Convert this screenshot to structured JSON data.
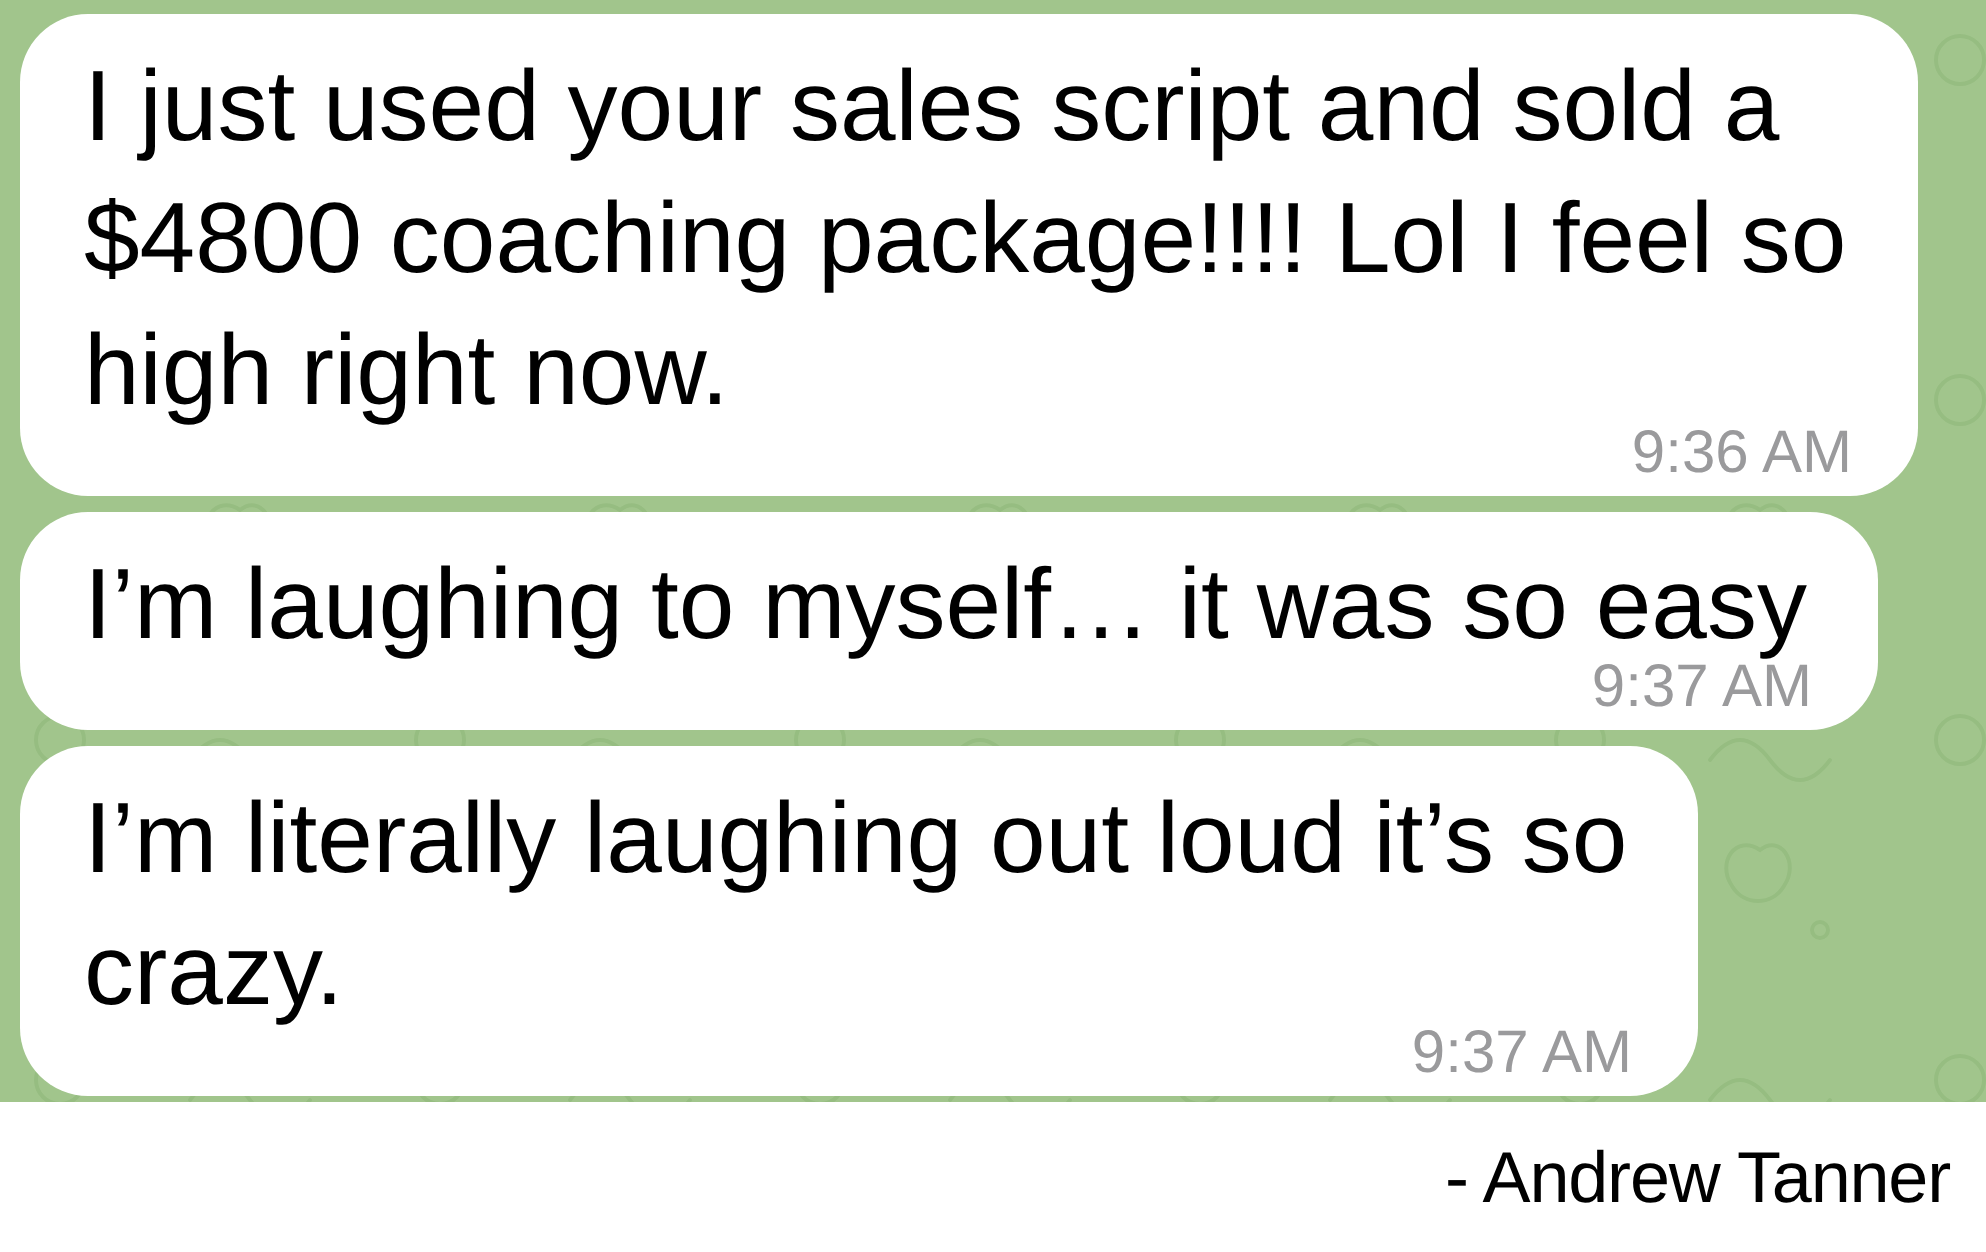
{
  "messages": [
    {
      "text": "I just used your sales script and sold a $4800 coaching package!!!! Lol I feel so high right now.",
      "time": "9:36 AM"
    },
    {
      "text": "I’m laughing to myself… it was so easy",
      "time": "9:37 AM"
    },
    {
      "text": "I’m literally laughing out loud it’s so crazy.",
      "time": "9:37 AM"
    }
  ],
  "attribution": "- Andrew Tanner"
}
